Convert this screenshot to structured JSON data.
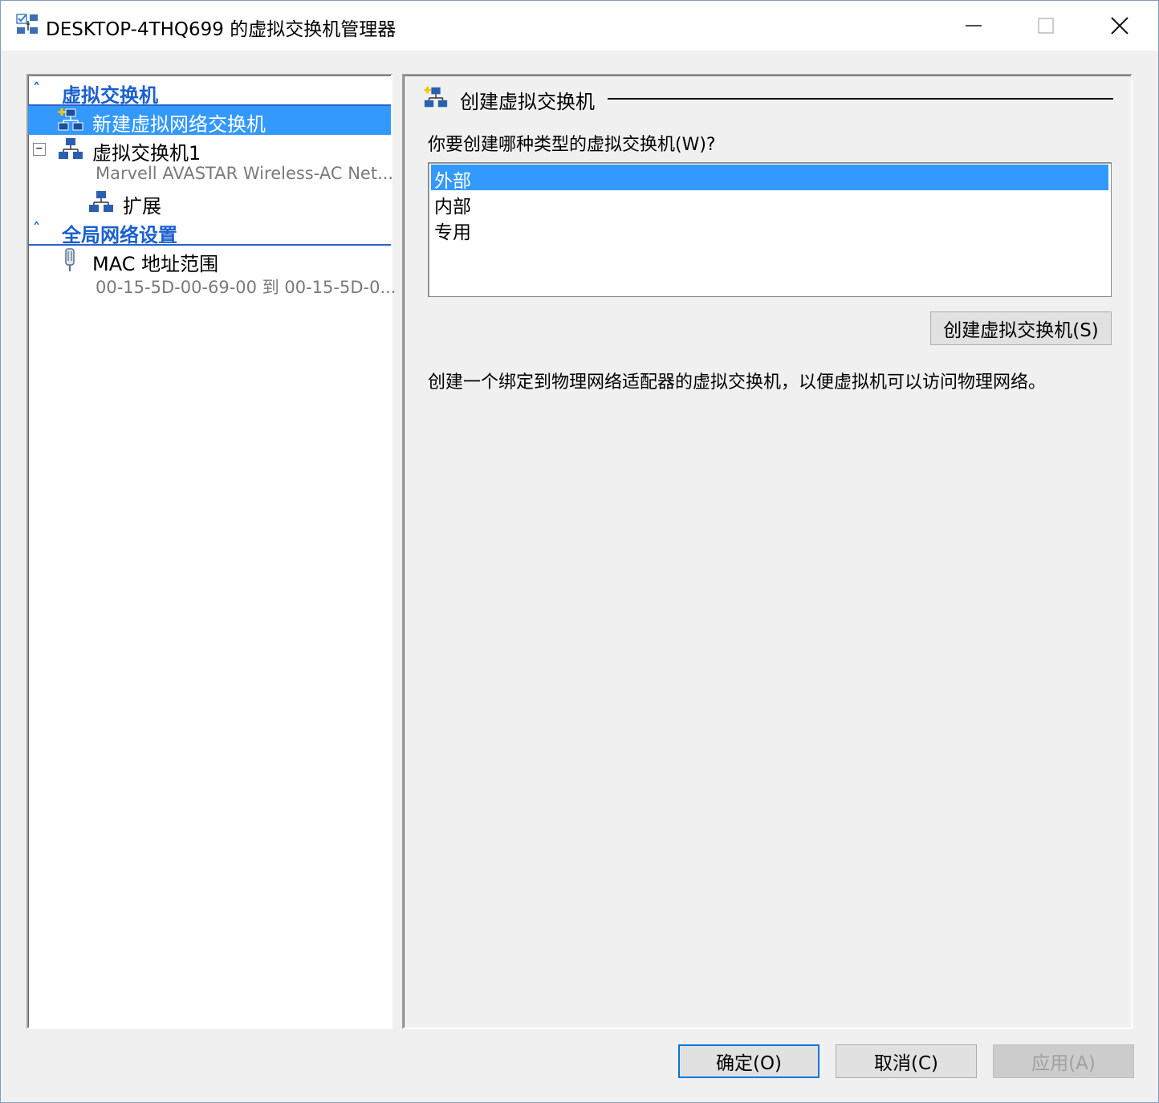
{
  "window": {
    "title": "DESKTOP-4THQ699 的虚拟交换机管理器"
  },
  "left_panel": {
    "section_switches": {
      "label": "虚拟交换机"
    },
    "new_switch": {
      "label": "新建虚拟网络交换机"
    },
    "switch1": {
      "label": "虚拟交换机1",
      "adapter": "Marvell AVASTAR Wireless-AC Net...",
      "extensions_label": "扩展"
    },
    "section_global": {
      "label": "全局网络设置"
    },
    "mac_range": {
      "label": "MAC 地址范围",
      "value": "00-15-5D-00-69-00 到 00-15-5D-0..."
    }
  },
  "right_panel": {
    "title": "创建虚拟交换机",
    "question": "你要创建哪种类型的虚拟交换机(W)?",
    "switch_types": [
      "外部",
      "内部",
      "专用"
    ],
    "selected_type": "外部",
    "create_button": "创建虚拟交换机(S)",
    "description": "创建一个绑定到物理网络适配器的虚拟交换机，以便虚拟机可以访问物理网络。"
  },
  "footer": {
    "ok": "确定(O)",
    "cancel": "取消(C)",
    "apply": "应用(A)"
  },
  "colors": {
    "selection": "#3399ff",
    "section_header": "#1a5fcf",
    "default_button_border": "#0078d7"
  }
}
